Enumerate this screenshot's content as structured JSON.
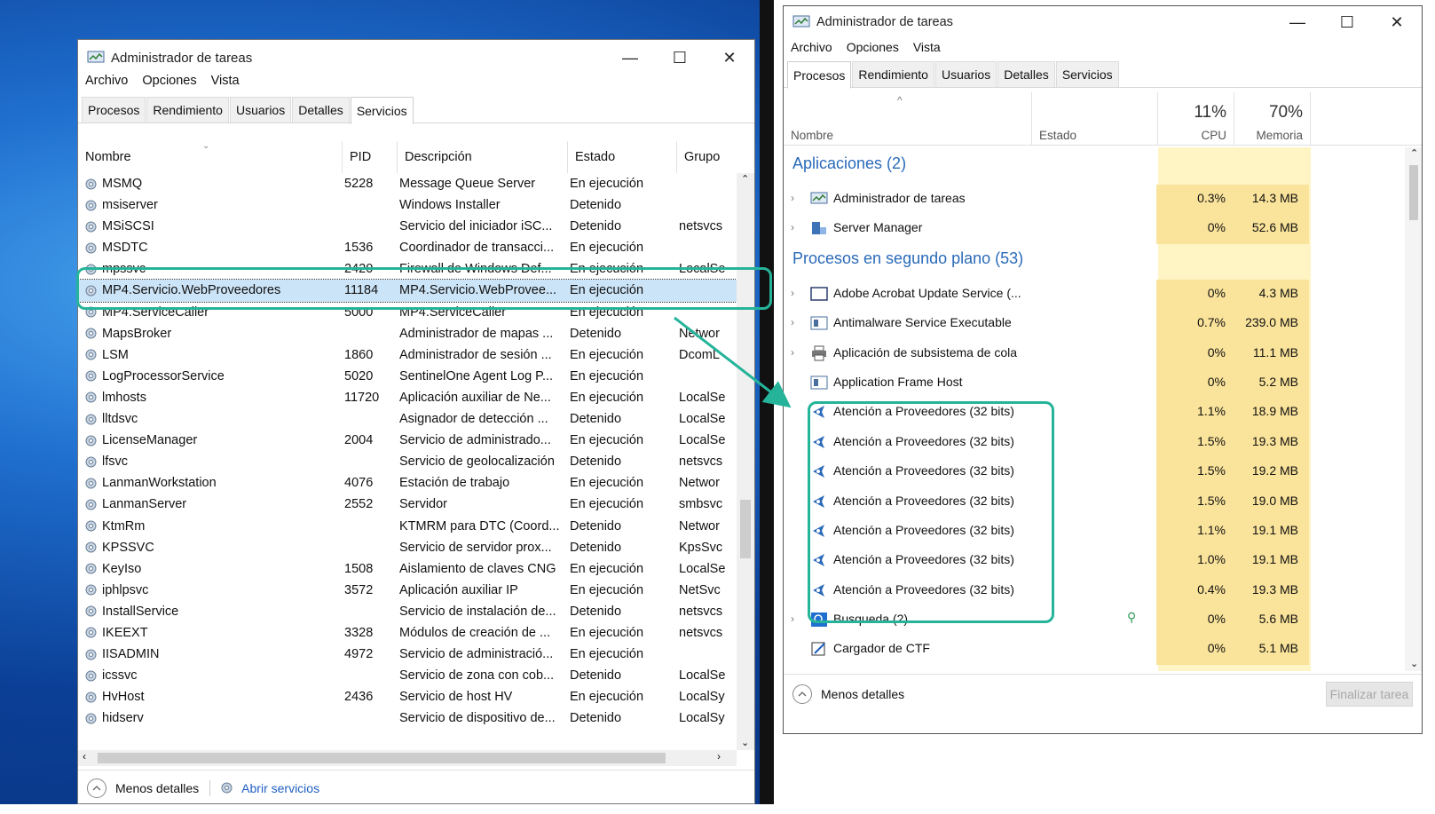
{
  "left_window": {
    "title": "Administrador de tareas",
    "controls": {
      "minimize": "—",
      "maximize": "☐",
      "close": "✕"
    },
    "menu": [
      "Archivo",
      "Opciones",
      "Vista"
    ],
    "tabs": [
      "Procesos",
      "Rendimiento",
      "Usuarios",
      "Detalles",
      "Servicios"
    ],
    "active_tab": "Servicios",
    "columns": [
      "Nombre",
      "PID",
      "Descripción",
      "Estado",
      "Grupo"
    ],
    "rows": [
      [
        "MSMQ",
        "5228",
        "Message Queue Server",
        "En ejecución",
        ""
      ],
      [
        "msiserver",
        "",
        "Windows Installer",
        "Detenido",
        ""
      ],
      [
        "MSiSCSI",
        "",
        "Servicio del iniciador iSC...",
        "Detenido",
        "netsvcs"
      ],
      [
        "MSDTC",
        "1536",
        "Coordinador de transacci...",
        "En ejecución",
        ""
      ],
      [
        "mpssvc",
        "2420",
        "Firewall de Windows Def...",
        "En ejecución",
        "LocalSe"
      ],
      [
        "MP4.Servicio.WebProveedores",
        "11184",
        "MP4.Servicio.WebProvee...",
        "En ejecución",
        ""
      ],
      [
        "MP4.ServiceCaller",
        "5000",
        "MP4.ServiceCaller",
        "En ejecución",
        ""
      ],
      [
        "MapsBroker",
        "",
        "Administrador de mapas ...",
        "Detenido",
        "Networ"
      ],
      [
        "LSM",
        "1860",
        "Administrador de sesión ...",
        "En ejecución",
        "DcomL"
      ],
      [
        "LogProcessorService",
        "5020",
        "SentinelOne Agent Log P...",
        "En ejecución",
        ""
      ],
      [
        "lmhosts",
        "11720",
        "Aplicación auxiliar de Ne...",
        "En ejecución",
        "LocalSe"
      ],
      [
        "lltdsvc",
        "",
        "Asignador de detección ...",
        "Detenido",
        "LocalSe"
      ],
      [
        "LicenseManager",
        "2004",
        "Servicio de administrado...",
        "En ejecución",
        "LocalSe"
      ],
      [
        "lfsvc",
        "",
        "Servicio de geolocalización",
        "Detenido",
        "netsvcs"
      ],
      [
        "LanmanWorkstation",
        "4076",
        "Estación de trabajo",
        "En ejecución",
        "Networ"
      ],
      [
        "LanmanServer",
        "2552",
        "Servidor",
        "En ejecución",
        "smbsvc"
      ],
      [
        "KtmRm",
        "",
        "KTMRM para DTC (Coord...",
        "Detenido",
        "Networ"
      ],
      [
        "KPSSVC",
        "",
        "Servicio de servidor prox...",
        "Detenido",
        "KpsSvc"
      ],
      [
        "KeyIso",
        "1508",
        "Aislamiento de claves CNG",
        "En ejecución",
        "LocalSe"
      ],
      [
        "iphlpsvc",
        "3572",
        "Aplicación auxiliar IP",
        "En ejecución",
        "NetSvc"
      ],
      [
        "InstallService",
        "",
        "Servicio de instalación de...",
        "Detenido",
        "netsvcs"
      ],
      [
        "IKEEXT",
        "3328",
        "Módulos de creación de ...",
        "En ejecución",
        "netsvcs"
      ],
      [
        "IISADMIN",
        "4972",
        "Servicio de administració...",
        "En ejecución",
        ""
      ],
      [
        "icssvc",
        "",
        "Servicio de zona con cob...",
        "Detenido",
        "LocalSe"
      ],
      [
        "HvHost",
        "2436",
        "Servicio de host HV",
        "En ejecución",
        "LocalSy"
      ],
      [
        "hidserv",
        "",
        "Servicio de dispositivo de...",
        "Detenido",
        "LocalSy"
      ]
    ],
    "footer": {
      "less_details": "Menos detalles",
      "open_services": "Abrir servicios"
    }
  },
  "right_window": {
    "title": "Administrador de tareas",
    "controls": {
      "minimize": "—",
      "maximize": "☐",
      "close": "✕"
    },
    "menu": [
      "Archivo",
      "Opciones",
      "Vista"
    ],
    "tabs": [
      "Procesos",
      "Rendimiento",
      "Usuarios",
      "Detalles",
      "Servicios"
    ],
    "active_tab": "Procesos",
    "header": {
      "name": "Nombre",
      "state": "Estado",
      "cpu_pct": "11%",
      "cpu_label": "CPU",
      "mem_pct": "70%",
      "mem_label": "Memoria"
    },
    "groups": [
      {
        "title": "Aplicaciones (2)",
        "items": [
          {
            "name": "Administrador de tareas",
            "cpu": "0.3%",
            "mem": "14.3 MB",
            "expandable": true,
            "icon": "taskmgr-icon"
          },
          {
            "name": "Server Manager",
            "cpu": "0%",
            "mem": "52.6 MB",
            "expandable": true,
            "icon": "server-manager-icon"
          }
        ]
      },
      {
        "title": "Procesos en segundo plano (53)",
        "items": [
          {
            "name": "Adobe Acrobat Update Service (...",
            "cpu": "0%",
            "mem": "4.3 MB",
            "expandable": true,
            "icon": "window-icon"
          },
          {
            "name": "Antimalware Service Executable",
            "cpu": "0.7%",
            "mem": "239.0 MB",
            "expandable": true,
            "icon": "app-icon"
          },
          {
            "name": "Aplicación de subsistema de cola",
            "cpu": "0%",
            "mem": "11.1 MB",
            "expandable": true,
            "icon": "printer-icon"
          },
          {
            "name": "Application Frame Host",
            "cpu": "0%",
            "mem": "5.2 MB",
            "expandable": false,
            "icon": "app-icon"
          },
          {
            "name": "Atención a Proveedores (32 bits)",
            "cpu": "1.1%",
            "mem": "18.9 MB",
            "expandable": false,
            "icon": "proveedores-icon"
          },
          {
            "name": "Atención a Proveedores (32 bits)",
            "cpu": "1.5%",
            "mem": "19.3 MB",
            "expandable": false,
            "icon": "proveedores-icon"
          },
          {
            "name": "Atención a Proveedores (32 bits)",
            "cpu": "1.5%",
            "mem": "19.2 MB",
            "expandable": false,
            "icon": "proveedores-icon"
          },
          {
            "name": "Atención a Proveedores (32 bits)",
            "cpu": "1.5%",
            "mem": "19.0 MB",
            "expandable": false,
            "icon": "proveedores-icon"
          },
          {
            "name": "Atención a Proveedores (32 bits)",
            "cpu": "1.1%",
            "mem": "19.1 MB",
            "expandable": false,
            "icon": "proveedores-icon"
          },
          {
            "name": "Atención a Proveedores (32 bits)",
            "cpu": "1.0%",
            "mem": "19.1 MB",
            "expandable": false,
            "icon": "proveedores-icon"
          },
          {
            "name": "Atención a Proveedores (32 bits)",
            "cpu": "0.4%",
            "mem": "19.3 MB",
            "expandable": false,
            "icon": "proveedores-icon"
          },
          {
            "name": "Busqueda (2)",
            "cpu": "0%",
            "mem": "5.6 MB",
            "expandable": true,
            "icon": "search-app-icon"
          },
          {
            "name": "Cargador de CTF",
            "cpu": "0%",
            "mem": "5.1 MB",
            "expandable": false,
            "icon": "ctf-icon"
          }
        ]
      }
    ],
    "footer": {
      "less_details": "Menos detalles",
      "end_task": "Finalizar tarea"
    }
  },
  "colors": {
    "highlight": "#25b49a",
    "group_title": "#2a6ab9",
    "heat": "#fae39a"
  }
}
